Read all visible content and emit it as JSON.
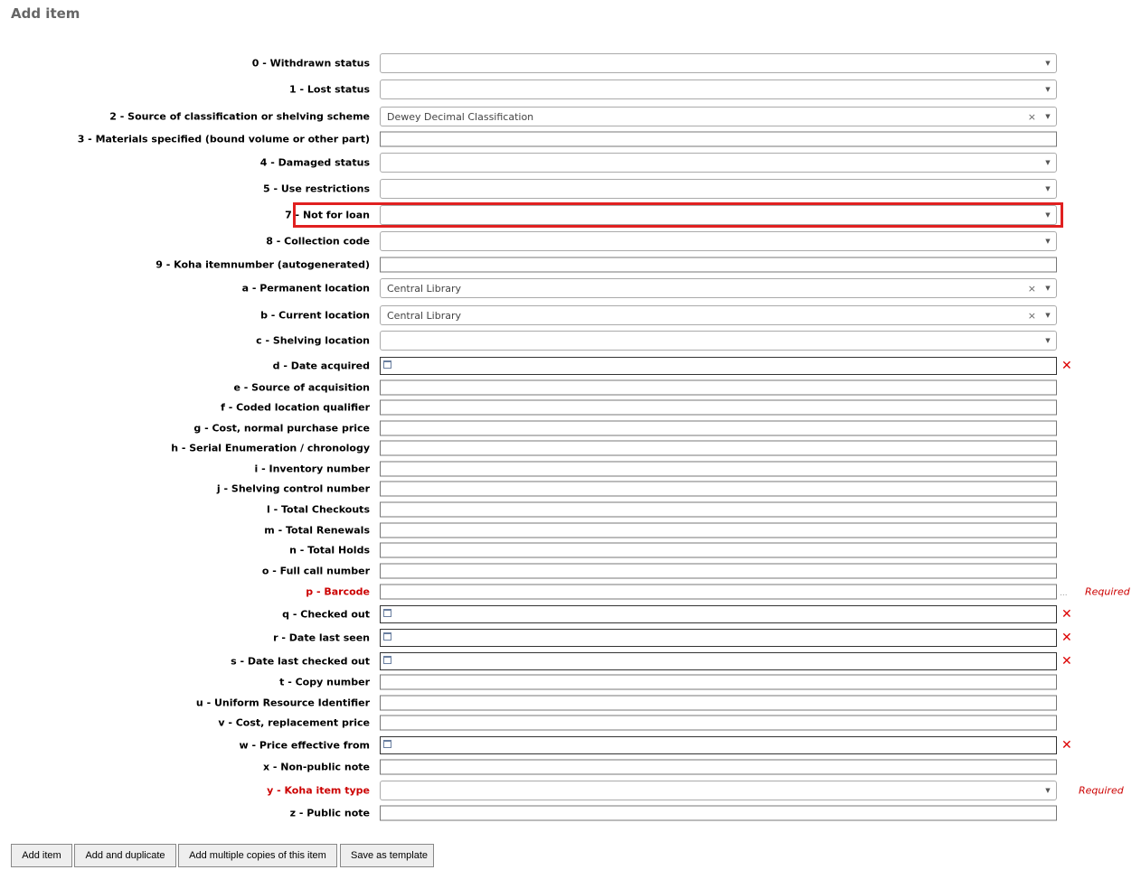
{
  "title": "Add item",
  "required_label": "Required",
  "fields": [
    {
      "label": "0 - Withdrawn status",
      "type": "select",
      "value": ""
    },
    {
      "label": "1 - Lost status",
      "type": "select",
      "value": ""
    },
    {
      "label": "2 - Source of classification or shelving scheme",
      "type": "select",
      "value": "Dewey Decimal Classification"
    },
    {
      "label": "3 - Materials specified (bound volume or other part)",
      "type": "text",
      "value": ""
    },
    {
      "label": "4 - Damaged status",
      "type": "select",
      "value": ""
    },
    {
      "label": "5 - Use restrictions",
      "type": "select",
      "value": ""
    },
    {
      "label": "7 - Not for loan",
      "type": "select",
      "value": "",
      "highlighted": true
    },
    {
      "label": "8 - Collection code",
      "type": "select",
      "value": ""
    },
    {
      "label": "9 - Koha itemnumber (autogenerated)",
      "type": "text",
      "value": ""
    },
    {
      "label": "a - Permanent location",
      "type": "select",
      "value": "Central Library"
    },
    {
      "label": "b - Current location",
      "type": "select",
      "value": "Central Library"
    },
    {
      "label": "c - Shelving location",
      "type": "select",
      "value": ""
    },
    {
      "label": "d - Date acquired",
      "type": "date",
      "value": ""
    },
    {
      "label": "e - Source of acquisition",
      "type": "text",
      "value": ""
    },
    {
      "label": "f - Coded location qualifier",
      "type": "text",
      "value": ""
    },
    {
      "label": "g - Cost, normal purchase price",
      "type": "text",
      "value": ""
    },
    {
      "label": "h - Serial Enumeration / chronology",
      "type": "text",
      "value": ""
    },
    {
      "label": "i - Inventory number",
      "type": "text",
      "value": ""
    },
    {
      "label": "j - Shelving control number",
      "type": "text",
      "value": ""
    },
    {
      "label": "l - Total Checkouts",
      "type": "text",
      "value": ""
    },
    {
      "label": "m - Total Renewals",
      "type": "text",
      "value": ""
    },
    {
      "label": "n - Total Holds",
      "type": "text",
      "value": ""
    },
    {
      "label": "o - Full call number",
      "type": "text",
      "value": ""
    },
    {
      "label": "p - Barcode",
      "type": "text",
      "value": "",
      "required": true,
      "plugin": "..."
    },
    {
      "label": "q - Checked out",
      "type": "date",
      "value": ""
    },
    {
      "label": "r - Date last seen",
      "type": "date",
      "value": ""
    },
    {
      "label": "s - Date last checked out",
      "type": "date",
      "value": ""
    },
    {
      "label": "t - Copy number",
      "type": "text",
      "value": ""
    },
    {
      "label": "u - Uniform Resource Identifier",
      "type": "text",
      "value": ""
    },
    {
      "label": "v - Cost, replacement price",
      "type": "text",
      "value": ""
    },
    {
      "label": "w - Price effective from",
      "type": "date",
      "value": ""
    },
    {
      "label": "x - Non-public note",
      "type": "text",
      "value": ""
    },
    {
      "label": "y - Koha item type",
      "type": "select",
      "value": "",
      "required": true
    },
    {
      "label": "z - Public note",
      "type": "text",
      "value": ""
    }
  ],
  "icons": {
    "dropdown": "▼",
    "clear": "×",
    "delete": "✕"
  },
  "buttons": [
    "Add item",
    "Add and duplicate",
    "Add multiple copies of this item",
    "Save as template"
  ]
}
